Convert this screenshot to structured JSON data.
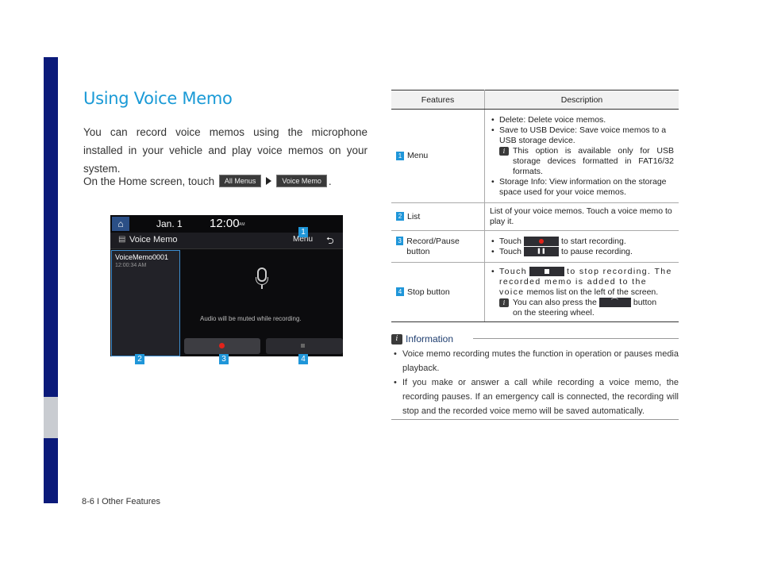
{
  "title": "Using Voice Memo",
  "intro": "You can record voice memos using the microphone installed in your vehicle and play voice memos on your system.",
  "home_line": {
    "prefix": "On the Home screen, touch",
    "chip1": "All Menus",
    "chip2": "Voice Memo",
    "suffix": "."
  },
  "screen": {
    "date": "Jan.  1",
    "time": "12:00",
    "ampm": "AM",
    "header_title": "Voice Memo",
    "menu": "Menu",
    "memo_name": "VoiceMemo0001",
    "memo_time": "12:00:34 AM",
    "muted_message": "Audio will be muted while recording."
  },
  "badges": {
    "b1": "1",
    "b2": "2",
    "b3": "3",
    "b4": "4"
  },
  "table": {
    "headers": [
      "Features",
      "Description"
    ],
    "rows": [
      {
        "num": "1",
        "feature": "Menu",
        "bullets": [
          "Delete: Delete voice memos.",
          "Save to USB Device: Save voice memos to a USB storage device."
        ],
        "note": "This option is available only for USB storage devices formatted in FAT16/32 formats.",
        "bullet3": "Storage Info: View information on the storage space used for your voice memos."
      },
      {
        "num": "2",
        "feature": "List",
        "desc": "List of your voice memos. Touch a voice memo to play it."
      },
      {
        "num": "3",
        "feature": "Record/Pause button",
        "touch": "Touch",
        "start": "to start recording.",
        "pause": "to pause recording."
      },
      {
        "num": "4",
        "feature": "Stop button",
        "touch": "Touch",
        "stop_a": "to stop recording. The recorded memo is added to the voice",
        "stop_b": "memos list on the left of the screen.",
        "note_a": "You can also press the",
        "note_b": "button",
        "note_c": "on the steering wheel."
      }
    ]
  },
  "info": {
    "heading": "Information",
    "items": [
      "Voice memo recording mutes the function in operation or pauses media playback.",
      "If you make or answer a call while recording a voice memo, the recording pauses. If an emergency call is connected, the recording will stop and the recorded voice memo will be saved automatically."
    ]
  },
  "footer": "8-6 I Other Features",
  "colors": {
    "accent": "#1a9ad6",
    "sidebar": "#0b1a7a",
    "record": "#e2231a"
  }
}
